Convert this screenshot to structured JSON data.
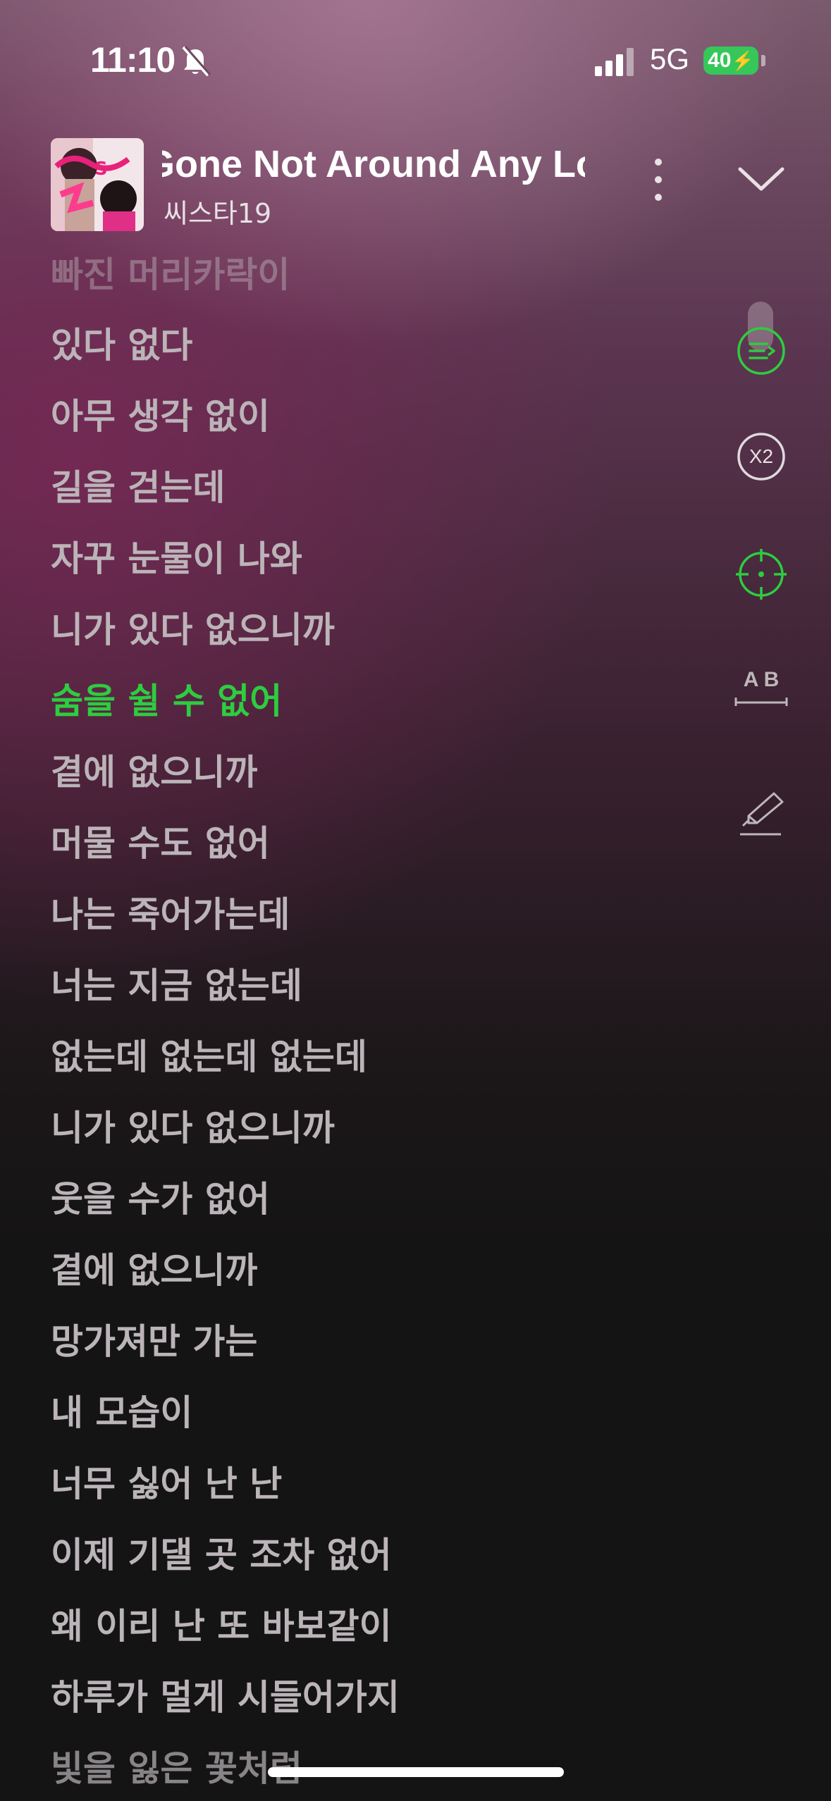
{
  "status_bar": {
    "time": "11:10",
    "network": "5G",
    "battery": "40"
  },
  "player": {
    "title": "Gone Not Around Any Longer",
    "artist": "씨스타19",
    "accent_color": "#2ecc40"
  },
  "lyrics": [
    "빠진 머리카락이",
    "있다 없다",
    "아무 생각 없이",
    "길을 걷는데",
    "자꾸 눈물이 나와",
    "니가 있다 없으니까",
    "숨을 쉴 수 없어",
    "곁에 없으니까",
    "머물 수도 없어",
    "나는 죽어가는데",
    "너는 지금 없는데",
    "없는데 없는데 없는데",
    "니가 있다 없으니까",
    "웃을 수가 없어",
    "곁에 없으니까",
    "망가져만 가는",
    "내 모습이",
    "너무 싫어 난 난",
    "이제 기댈 곳 조차 없어",
    "왜 이리 난 또 바보같이",
    "하루가 멀게 시들어가지",
    "빛을 잃은 꽃처럼"
  ],
  "active_line_index": 6,
  "controls": {
    "speed_label": "X2",
    "translate_label": "A B"
  }
}
